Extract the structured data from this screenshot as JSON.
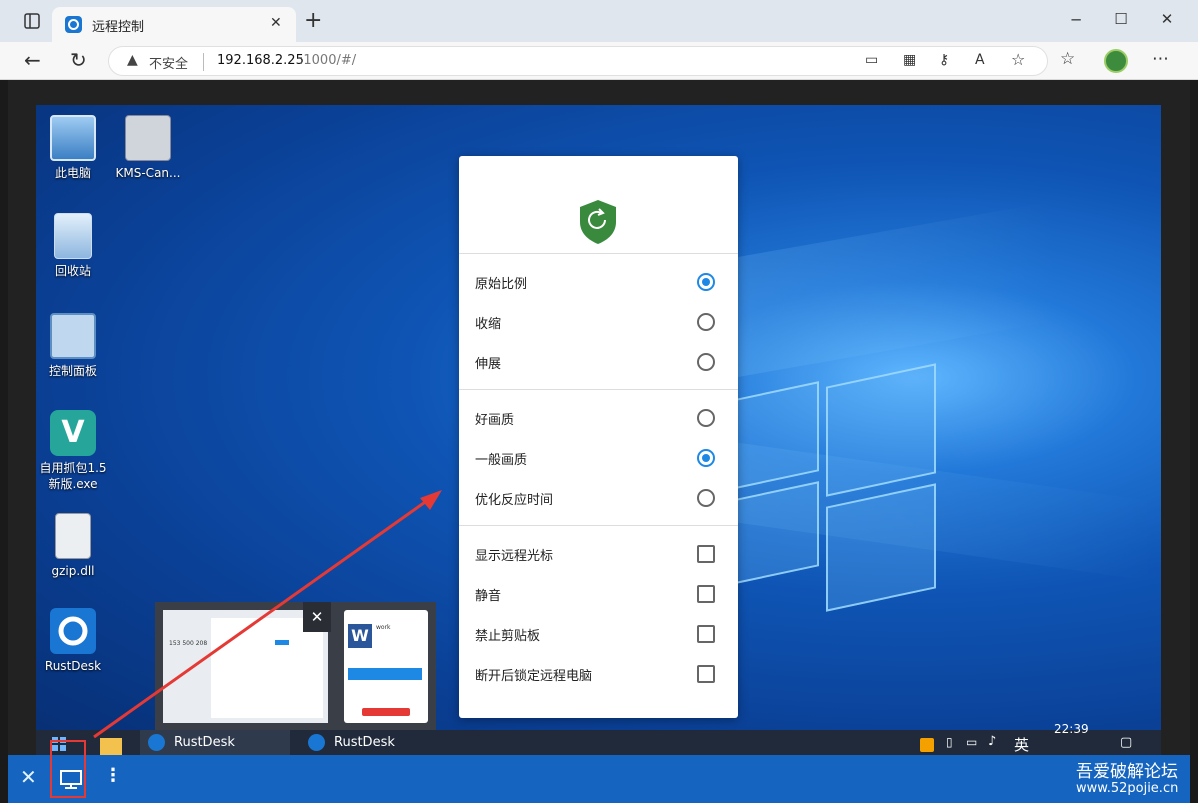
{
  "browser": {
    "tab_title": "远程控制",
    "new_tab": "+",
    "security_text": "不安全",
    "url_host": "192.168.2.25",
    "url_rest": ":1000/#/",
    "window_controls": [
      "─",
      "☐",
      "✕"
    ]
  },
  "desktop": {
    "icons": [
      {
        "label": "此电脑",
        "icon": "computer-icon"
      },
      {
        "label": "KMS-Can...",
        "icon": "gear-file-icon"
      },
      {
        "label": "回收站",
        "icon": "recycle-bin-icon"
      },
      {
        "label": "控制面板",
        "icon": "control-panel-icon"
      },
      {
        "label": "自用抓包1.5新版.exe",
        "icon": "app-v-icon"
      },
      {
        "label": "gzip.dll",
        "icon": "dll-file-icon"
      },
      {
        "label": "RustDesk",
        "icon": "rustdesk-icon"
      }
    ]
  },
  "panel": {
    "logo": "shield-refresh-icon",
    "scale": [
      {
        "label": "原始比例",
        "selected": true
      },
      {
        "label": "收缩",
        "selected": false
      },
      {
        "label": "伸展",
        "selected": false
      }
    ],
    "quality": [
      {
        "label": "好画质",
        "selected": false
      },
      {
        "label": "一般画质",
        "selected": true
      },
      {
        "label": "优化反应时间",
        "selected": false
      }
    ],
    "options": [
      {
        "label": "显示远程光标",
        "checked": false
      },
      {
        "label": "静音",
        "checked": false
      },
      {
        "label": "禁止剪贴板",
        "checked": false
      },
      {
        "label": "断开后锁定远程电脑",
        "checked": false
      }
    ]
  },
  "thumb": {
    "close": "✕",
    "id_number": "153 500 208",
    "word_title": "work",
    "word_letter": "W"
  },
  "taskbar": {
    "items": [
      "RustDesk",
      "RustDesk"
    ],
    "time": "22:39",
    "lang": "英"
  },
  "watermark": {
    "title": "吾爱破解论坛",
    "url": "www.52pojie.cn"
  },
  "colors": {
    "accent": "#1e88e5",
    "shield": "#3a8a3e",
    "bottombar": "#1565c0",
    "annotation": "#e53935"
  }
}
